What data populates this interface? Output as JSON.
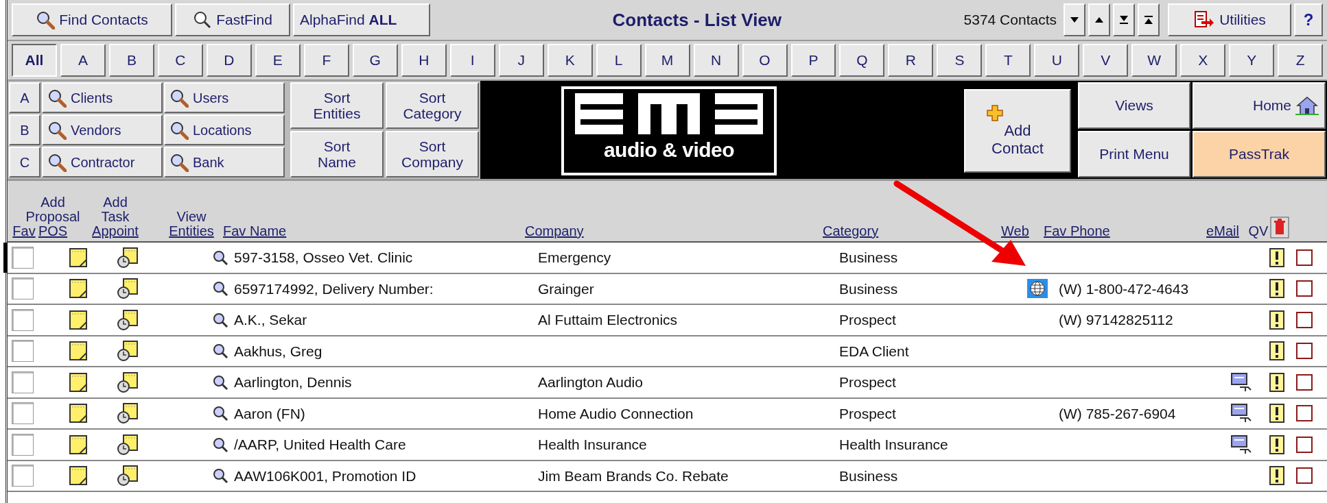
{
  "toolbar": {
    "find_contacts": "Find Contacts",
    "fastfind": "FastFind",
    "alphafind_label": "AlphaFind",
    "alphafind_value": "ALL",
    "title": "Contacts - List View",
    "count": "5374 Contacts",
    "utilities": "Utilities",
    "help": "?"
  },
  "letters": [
    {
      "label": "All",
      "selected": true
    },
    {
      "label": "A",
      "selected": false
    },
    {
      "label": "B",
      "selected": false
    },
    {
      "label": "C",
      "selected": false
    },
    {
      "label": "D",
      "selected": false
    },
    {
      "label": "E",
      "selected": false
    },
    {
      "label": "F",
      "selected": false
    },
    {
      "label": "G",
      "selected": false
    },
    {
      "label": "H",
      "selected": false
    },
    {
      "label": "I",
      "selected": false
    },
    {
      "label": "J",
      "selected": false
    },
    {
      "label": "K",
      "selected": false
    },
    {
      "label": "L",
      "selected": false
    },
    {
      "label": "M",
      "selected": false
    },
    {
      "label": "N",
      "selected": false
    },
    {
      "label": "O",
      "selected": false
    },
    {
      "label": "P",
      "selected": false
    },
    {
      "label": "Q",
      "selected": false
    },
    {
      "label": "R",
      "selected": false
    },
    {
      "label": "S",
      "selected": false
    },
    {
      "label": "T",
      "selected": false
    },
    {
      "label": "U",
      "selected": false
    },
    {
      "label": "V",
      "selected": false
    },
    {
      "label": "W",
      "selected": false
    },
    {
      "label": "X",
      "selected": false
    },
    {
      "label": "Y",
      "selected": false
    },
    {
      "label": "Z",
      "selected": false
    }
  ],
  "groups": [
    {
      "letter": "A",
      "left": "Clients",
      "right": "Users"
    },
    {
      "letter": "B",
      "left": "Vendors",
      "right": "Locations"
    },
    {
      "letter": "C",
      "left": "Contractor",
      "right": "Bank"
    }
  ],
  "sort_buttons": [
    "Sort Entities",
    "Sort Category",
    "Sort Name",
    "Sort Company"
  ],
  "logo": {
    "tagline": "audio & video"
  },
  "add_contact": "Add Contact",
  "nav_buttons": [
    {
      "label": "Views",
      "highlighted": false,
      "kind": "text"
    },
    {
      "label": "Home",
      "highlighted": false,
      "kind": "home"
    },
    {
      "label": "Print Menu",
      "highlighted": false,
      "kind": "text"
    },
    {
      "label": "PassTrak",
      "highlighted": true,
      "kind": "text"
    }
  ],
  "columns": [
    {
      "link": "Fav"
    },
    {
      "top": "Add Proposal",
      "link": "POS"
    },
    {
      "top": "Add Task",
      "link": "Appoint"
    },
    {
      "top": "View",
      "link": "Entities"
    },
    {
      "link": "Fav Name"
    },
    {
      "link": "Company"
    },
    {
      "link": "Category"
    },
    {
      "link": "Web"
    },
    {
      "link": "Fav Phone"
    },
    {
      "link": "eMail"
    },
    {
      "label": "QV"
    }
  ],
  "rows": [
    {
      "current": true,
      "fav": false,
      "name": "597-3158, Osseo Vet. Clinic",
      "company": "Emergency",
      "category": "Business",
      "web": false,
      "email": false,
      "delete": false
    },
    {
      "current": false,
      "fav": false,
      "name": "6597174992, Delivery Number:",
      "company": "Grainger",
      "category": "Business",
      "web": true,
      "phone": "(W) 1-800-472-4643",
      "email": false,
      "delete": false
    },
    {
      "current": false,
      "fav": false,
      "name": "A.K., Sekar",
      "company": "Al Futtaim Electronics",
      "category": "Prospect",
      "web": false,
      "phone": "(W) 97142825112",
      "email": false,
      "delete": false
    },
    {
      "current": false,
      "fav": false,
      "name": "Aakhus, Greg",
      "category": "EDA Client",
      "web": false,
      "email": false,
      "delete": false
    },
    {
      "current": false,
      "fav": false,
      "name": "Aarlington, Dennis",
      "company": "Aarlington Audio",
      "category": "Prospect",
      "web": false,
      "email": true,
      "delete": false
    },
    {
      "current": false,
      "fav": false,
      "name": "Aaron (FN)",
      "company": "Home Audio Connection",
      "category": "Prospect",
      "web": false,
      "phone": "(W) 785-267-6904",
      "email": true,
      "delete": false
    },
    {
      "current": false,
      "fav": false,
      "name": "/AARP, United Health Care",
      "company": "Health Insurance",
      "category": "Health Insurance",
      "web": false,
      "email": true,
      "delete": false
    },
    {
      "current": false,
      "fav": false,
      "name": "AAW106K001, Promotion ID",
      "company": "Jim Beam Brands Co. Rebate",
      "category": "Business",
      "web": false,
      "email": false,
      "delete": false
    }
  ]
}
